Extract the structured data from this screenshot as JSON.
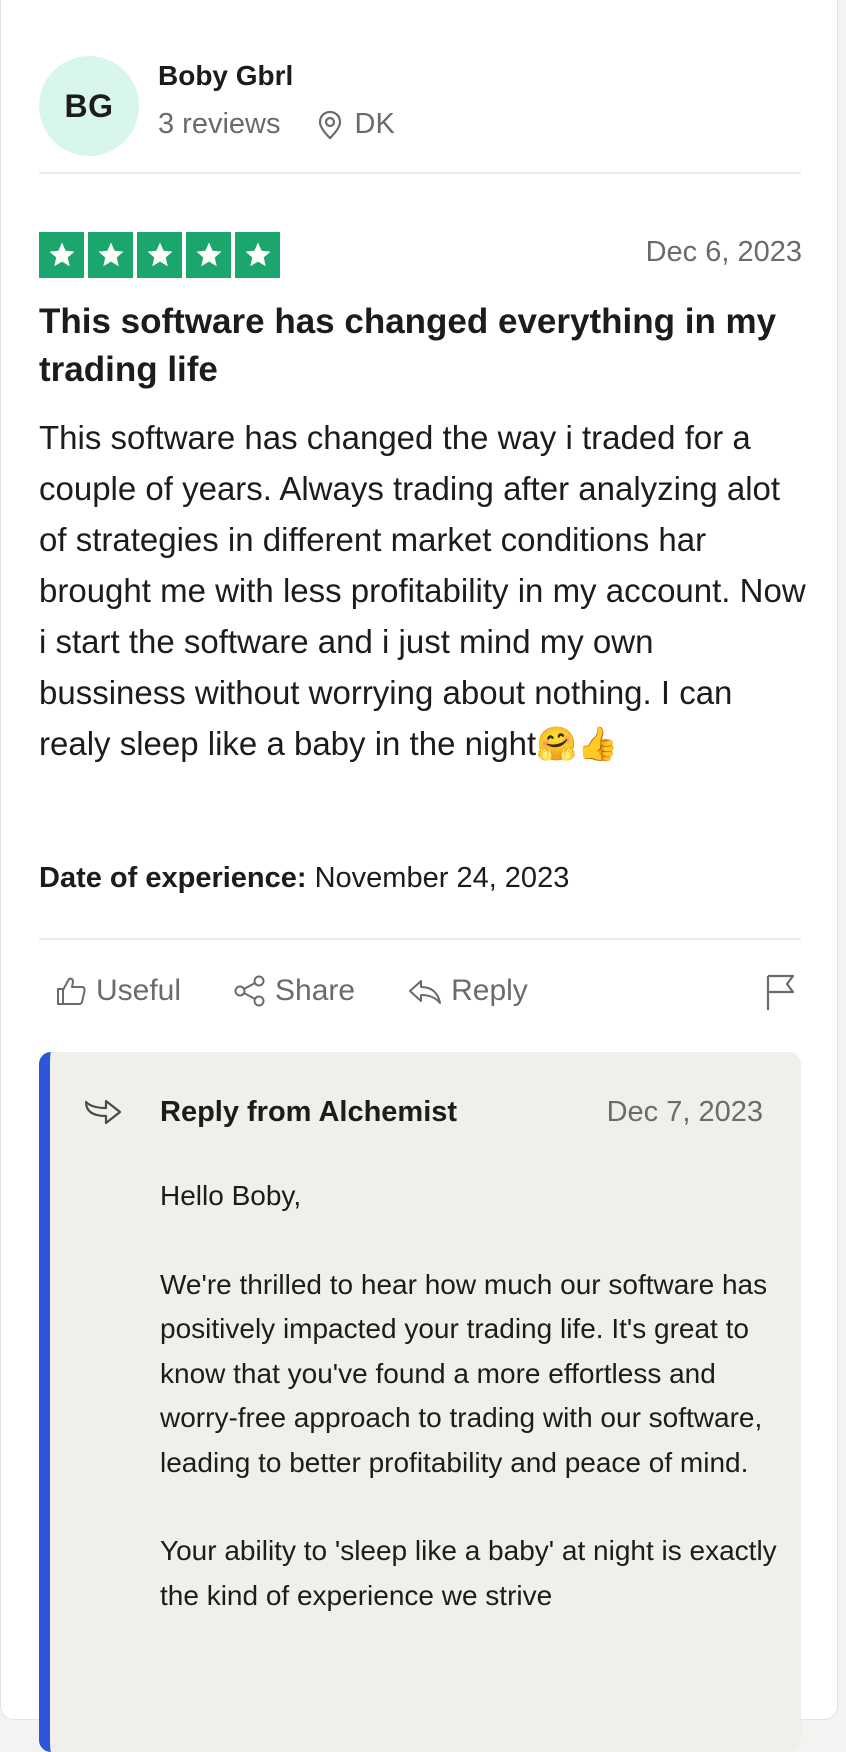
{
  "reviewer": {
    "initials": "BG",
    "name": "Boby Gbrl",
    "reviews": "3 reviews",
    "location": "DK"
  },
  "review": {
    "rating": 5,
    "rating_color": "#1ba66e",
    "date": "Dec 6, 2023",
    "title": "This software has changed everything in my trading life",
    "body": "This software has changed the way i traded for a couple of years. Always trading after analyzing alot of strategies in different market conditions har brought me with less profitability in my account. Now i start the software and i just mind my own bussiness without worrying about nothing. I can realy sleep like a baby in the night🤗👍",
    "experience_label": "Date of experience:",
    "experience_date": "November 24, 2023"
  },
  "actions": {
    "useful": "Useful",
    "share": "Share",
    "reply": "Reply"
  },
  "company_reply": {
    "from": "Reply from Alchemist",
    "date": "Dec 7, 2023",
    "accent_color": "#2d55d8",
    "greeting": "Hello Boby,",
    "paragraph1": "We're thrilled to hear how much our software has positively impacted your trading life. It's great to know that you've found a more effortless and worry-free approach to trading with our software, leading to better profitability and peace of mind.",
    "paragraph2": "Your ability to 'sleep like a baby' at night is exactly the kind of experience we strive"
  }
}
